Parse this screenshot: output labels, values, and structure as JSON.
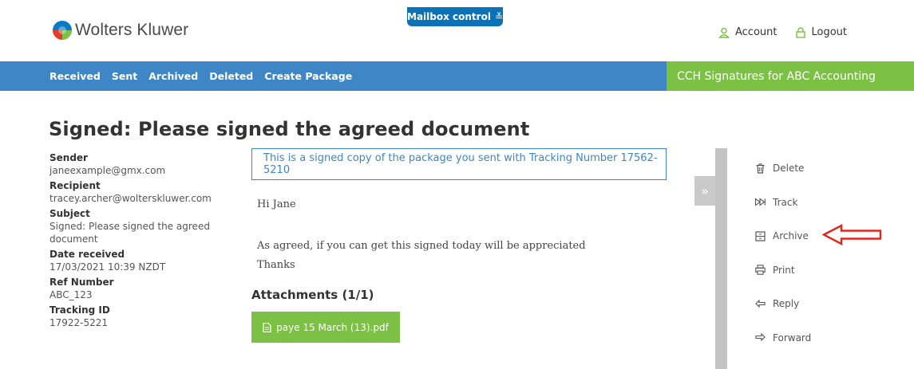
{
  "header": {
    "logo_text": "Wolters Kluwer",
    "mailbox_button": "Mailbox control",
    "account_label": "Account",
    "logout_label": "Logout"
  },
  "nav": {
    "items": [
      "Received",
      "Sent",
      "Archived",
      "Deleted",
      "Create Package"
    ],
    "brand": "CCH Signatures for ABC Accounting"
  },
  "page_title": "Signed: Please signed the agreed document",
  "meta": {
    "sender_label": "Sender",
    "sender": "janeexample@gmx.com",
    "recipient_label": "Recipient",
    "recipient": "tracey.archer@wolterskluwer.com",
    "subject_label": "Subject",
    "subject": "Signed: Please signed the agreed document",
    "date_label": "Date received",
    "date": "17/03/2021 10:39 NZDT",
    "ref_label": "Ref Number",
    "ref": "ABC_123",
    "tracking_label": "Tracking ID",
    "tracking": "17922-5221"
  },
  "message": {
    "notice": "This is a signed copy of the package you sent with Tracking Number 17562-5210",
    "greeting": "Hi Jane",
    "body": "As agreed, if you can get this signed today will be appreciated",
    "closing": "Thanks"
  },
  "attachments": {
    "title": "Attachments (1/1)",
    "file": "paye 15 March (13).pdf"
  },
  "actions": {
    "delete": "Delete",
    "track": "Track",
    "archive": "Archive",
    "print": "Print",
    "reply": "Reply",
    "forward": "Forward"
  },
  "colors": {
    "nav_blue": "#3f86c7",
    "brand_green": "#7bc143",
    "mailbox_blue": "#0b72b7",
    "arrow_red": "#e0261b"
  }
}
